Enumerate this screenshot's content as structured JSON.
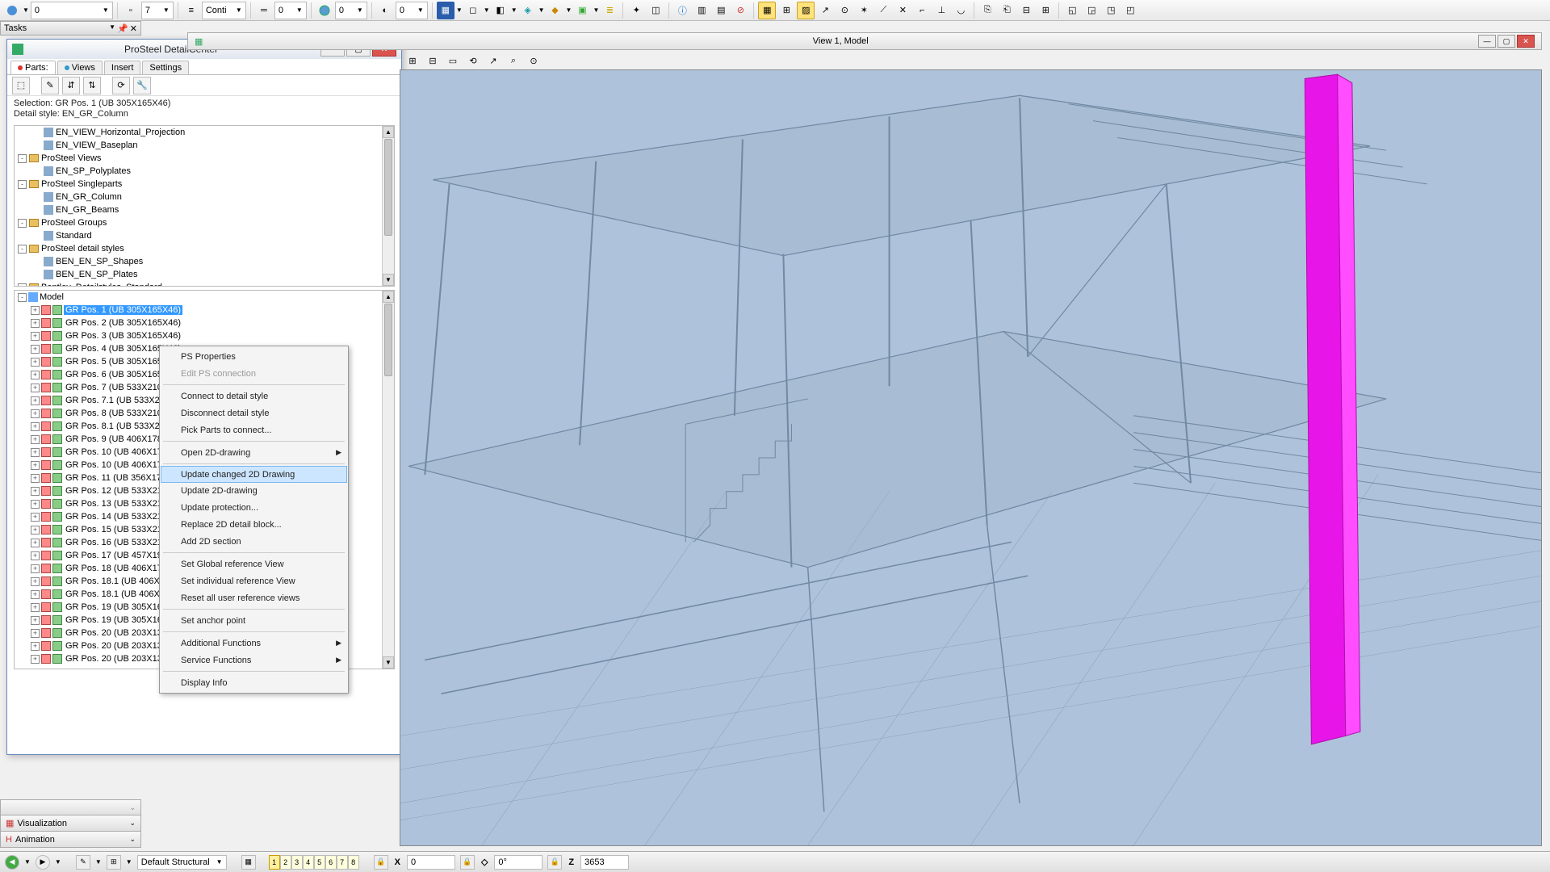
{
  "toolbar": {
    "layer_value": "0",
    "spin1": "7",
    "line_style": "Conti",
    "spin2": "0",
    "spin3": "0",
    "spin4": "0"
  },
  "tasks": {
    "title": "Tasks"
  },
  "detail_center": {
    "title": "ProSteel DetailCenter",
    "tabs": [
      "Parts:",
      "Views",
      "Insert",
      "Settings"
    ],
    "active_tab": 0,
    "selection_line": "Selection: GR Pos. 1 (UB 305X165X46)",
    "style_line": "Detail style: EN_GR_Column",
    "tree": [
      {
        "label": "Bentley_Detailstyles_Standard",
        "indent": 0,
        "exp": "-",
        "icon": "folder"
      },
      {
        "label": "BEN_EN_SP_Plates",
        "indent": 1,
        "icon": "plate"
      },
      {
        "label": "BEN_EN_SP_Shapes",
        "indent": 1,
        "icon": "shape"
      },
      {
        "label": "ProSteel detail styles",
        "indent": 0,
        "exp": "-",
        "icon": "folder"
      },
      {
        "label": "Standard",
        "indent": 1,
        "icon": "doc"
      },
      {
        "label": "ProSteel Groups",
        "indent": 0,
        "exp": "-",
        "icon": "folder"
      },
      {
        "label": "EN_GR_Beams",
        "indent": 1,
        "icon": "beam"
      },
      {
        "label": "EN_GR_Column",
        "indent": 1,
        "icon": "beam"
      },
      {
        "label": "ProSteel Singleparts",
        "indent": 0,
        "exp": "-",
        "icon": "folder"
      },
      {
        "label": "EN_SP_Polyplates",
        "indent": 1,
        "icon": "plate"
      },
      {
        "label": "ProSteel Views",
        "indent": 0,
        "exp": "-",
        "icon": "folder"
      },
      {
        "label": "EN_VIEW_Baseplan",
        "indent": 1,
        "icon": "view"
      },
      {
        "label": "EN_VIEW_Horizontal_Projection",
        "indent": 1,
        "icon": "view"
      }
    ],
    "model_root": "Model",
    "model_items": [
      "GR Pos. 1 (UB 305X165X46)",
      "GR Pos. 2 (UB 305X165X46)",
      "GR Pos. 3 (UB 305X165X46)",
      "GR Pos. 4 (UB 305X165X46)",
      "GR Pos. 5 (UB 305X165X46)",
      "GR Pos. 6 (UB 305X165X46)",
      "GR Pos. 7 (UB 533X210X92)",
      "GR Pos. 7.1 (UB 533X210X92)",
      "GR Pos. 8 (UB 533X210X92)",
      "GR Pos. 8.1 (UB 533X210X92)",
      "GR Pos. 9 (UB 406X178X60)",
      "GR Pos. 10 (UB 406X178X60)",
      "GR Pos. 10 (UB 406X178X60)",
      "GR Pos. 11 (UB 356X171X51)",
      "GR Pos. 12 (UB 533X210X92)",
      "GR Pos. 13 (UB 533X210X92)",
      "GR Pos. 14 (UB 533X210X92)",
      "GR Pos. 15 (UB 533X210X92)",
      "GR Pos. 16 (UB 533X210X92)",
      "GR Pos. 17 (UB 457X191X74)",
      "GR Pos. 18 (UB 406X178X60)",
      "GR Pos. 18.1 (UB 406X178X60)",
      "GR Pos. 18.1 (UB 406X178X60)",
      "GR Pos. 19 (UB 305X165X46)",
      "GR Pos. 19 (UB 305X165X46)",
      "GR Pos. 20 (UB 203X133X30)",
      "GR Pos. 20 (UB 203X133X30)",
      "GR Pos. 20 (UB 203X133X30)"
    ],
    "selected_index": 0
  },
  "context_menu": {
    "items": [
      {
        "label": "PS Properties"
      },
      {
        "label": "Edit PS connection",
        "disabled": true
      },
      {
        "sep": true
      },
      {
        "label": "Connect to detail style"
      },
      {
        "label": "Disconnect detail style"
      },
      {
        "label": "Pick Parts to connect..."
      },
      {
        "sep": true
      },
      {
        "label": "Open 2D-drawing",
        "sub": true
      },
      {
        "sep": true
      },
      {
        "label": "Update changed 2D Drawing",
        "highlight": true
      },
      {
        "label": "Update 2D-drawing"
      },
      {
        "label": "Update protection..."
      },
      {
        "label": "Replace 2D detail block..."
      },
      {
        "label": "Add 2D section"
      },
      {
        "sep": true
      },
      {
        "label": "Set Global reference View"
      },
      {
        "label": "Set individual reference View"
      },
      {
        "label": "Reset all user reference views"
      },
      {
        "sep": true
      },
      {
        "label": "Set anchor point"
      },
      {
        "sep": true
      },
      {
        "label": "Additional Functions",
        "sub": true
      },
      {
        "label": "Service Functions",
        "sub": true
      },
      {
        "sep": true
      },
      {
        "label": "Display Info"
      }
    ]
  },
  "accordion": [
    "Visualization",
    "Animation"
  ],
  "viewport": {
    "title": "View 1, Model"
  },
  "status": {
    "layer_dropdown": "Default Structural",
    "grid_buttons": [
      "1",
      "2",
      "3",
      "4",
      "5",
      "6",
      "7",
      "8"
    ],
    "x_label": "X",
    "x_value": "0",
    "rot_label": "◇",
    "rot_value": "0°",
    "z_label": "Z",
    "z_value": "3653"
  }
}
